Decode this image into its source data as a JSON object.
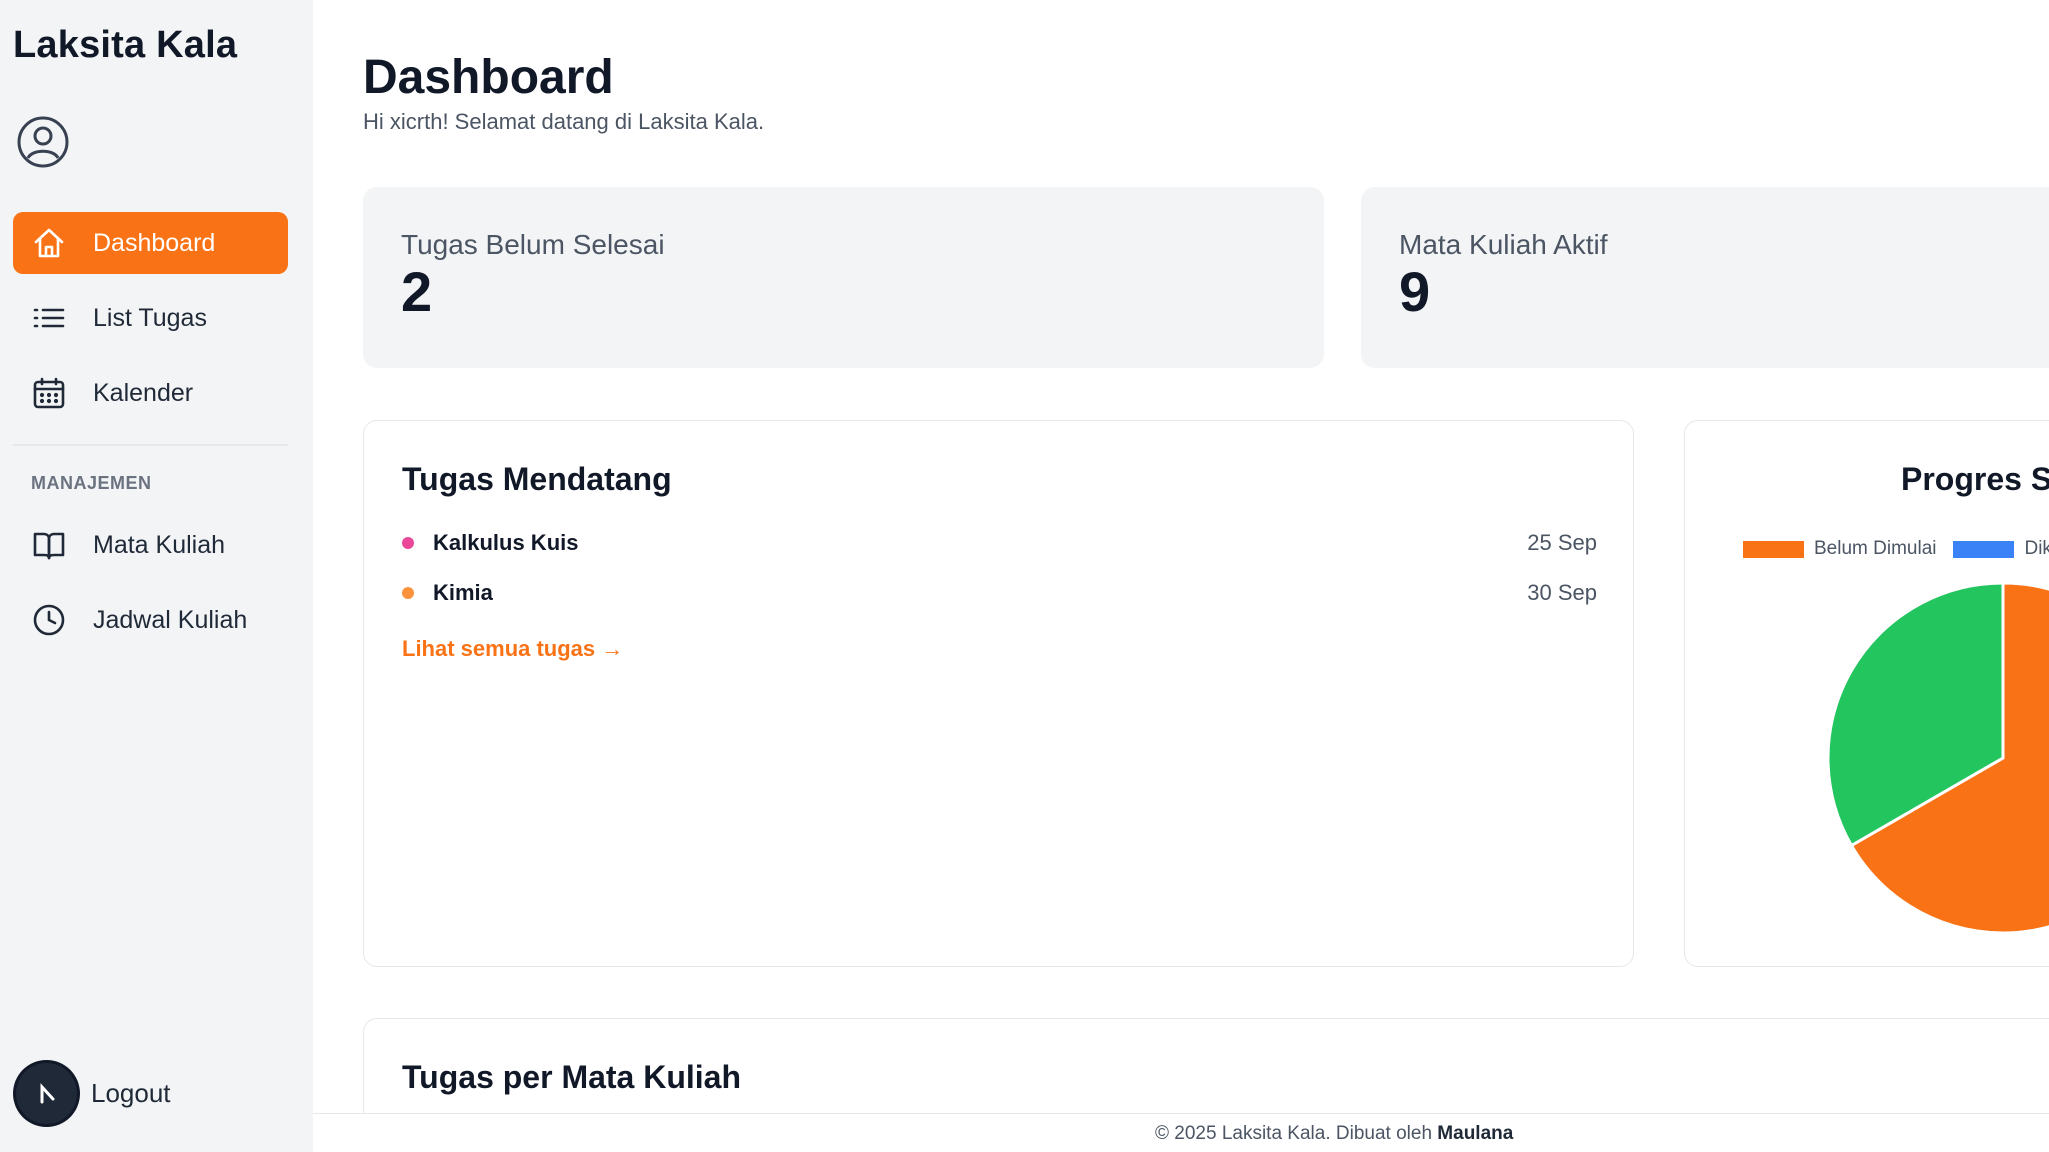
{
  "app": {
    "brand": "Laksita Kala"
  },
  "sidebar": {
    "items": [
      {
        "label": "Dashboard",
        "icon": "home-icon",
        "active": true
      },
      {
        "label": "List Tugas",
        "icon": "list-icon",
        "active": false
      },
      {
        "label": "Kalender",
        "icon": "calendar-icon",
        "active": false
      }
    ],
    "section_label": "MANAJEMEN",
    "manage_items": [
      {
        "label": "Mata Kuliah",
        "icon": "book-icon"
      },
      {
        "label": "Jadwal Kuliah",
        "icon": "clock-icon"
      }
    ],
    "logout_label": "Logout"
  },
  "header": {
    "title": "Dashboard",
    "subtitle": "Hi xicrth! Selamat datang di Laksita Kala."
  },
  "stats": [
    {
      "label": "Tugas Belum Selesai",
      "value": "2"
    },
    {
      "label": "Mata Kuliah Aktif",
      "value": "9"
    }
  ],
  "upcoming": {
    "title": "Tugas Mendatang",
    "tasks": [
      {
        "name": "Kalkulus Kuis",
        "date": "25 Sep",
        "dot_color": "#ec4899"
      },
      {
        "name": "Kimia",
        "date": "30 Sep",
        "dot_color": "#fb923c"
      }
    ],
    "see_all": "Lihat semua tugas →"
  },
  "progress": {
    "title": "Progres S",
    "legend": [
      {
        "label": "Belum Dimulai",
        "color": "#f97316"
      },
      {
        "label": "Dik",
        "color": "#3b82f6"
      }
    ]
  },
  "chart_data": {
    "type": "pie",
    "title": "Progres S",
    "categories": [
      "Belum Dimulai",
      "Dik",
      ""
    ],
    "values": [
      2,
      0,
      1
    ],
    "colors": [
      "#f97316",
      "#3b82f6",
      "#22c55e"
    ]
  },
  "per_mk": {
    "title": "Tugas per Mata Kuliah"
  },
  "footer": {
    "text": "© 2025 Laksita Kala. Dibuat oleh ",
    "author": "Maulana"
  },
  "colors": {
    "accent": "#f97316",
    "sidebar_bg": "#f3f4f6",
    "card_bg": "#f3f4f6"
  }
}
